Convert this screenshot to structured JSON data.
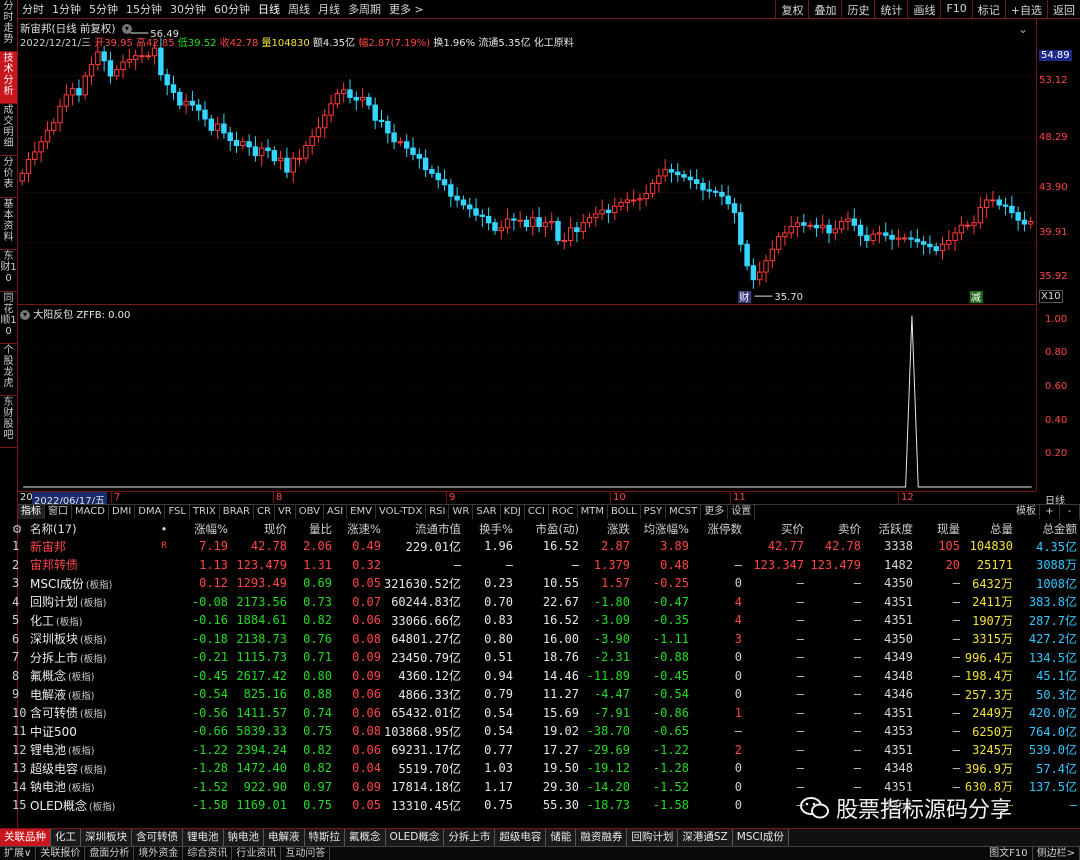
{
  "periods": [
    "分时",
    "1分钟",
    "5分钟",
    "15分钟",
    "30分钟",
    "60分钟",
    "日线",
    "周线",
    "月线",
    "多周期",
    "更多 >"
  ],
  "active_period": "日线",
  "top_buttons": [
    "复权",
    "叠加",
    "历史",
    "统计",
    "画线",
    "F10",
    "标记",
    "+自选",
    "返回"
  ],
  "left_tabs": [
    "分时走势",
    "技术分析",
    "成交明细",
    "分价表",
    "基本资料",
    "东财10",
    "同花顺10",
    "个股龙虎",
    "东财股吧"
  ],
  "active_left_tab": "技术分析",
  "chart_title": "新宙邦(日线 前复权)",
  "info": {
    "date": "2022/12/21/三",
    "open_label": "开",
    "open": "39.95",
    "high_label": "高",
    "high": "42.85",
    "low_label": "低",
    "low": "39.52",
    "close_label": "收",
    "close": "42.78",
    "vol_label": "量",
    "vol": "104830",
    "amt_label": "额",
    "amt": "4.35亿",
    "chg_label": "幅",
    "chg": "2.87(7.19%)",
    "turn": "换1.96%",
    "float": "流通5.35亿",
    "industry": "化工原料"
  },
  "price_scale": [
    "54.89",
    "53.12",
    "48.29",
    "43.90",
    "39.91",
    "35.92"
  ],
  "price_scale_highlight": "54.89",
  "annot_high": "56.49",
  "annot_low": "35.70",
  "marker_cai": "财",
  "marker_jian": "减",
  "x10": "X10",
  "indicator_title": "大阳反包",
  "indicator_value": "ZFFB: 0.00",
  "ind_scale": [
    "1.00",
    "0.80",
    "0.60",
    "0.40",
    "0.20"
  ],
  "x_date_box": "2022/06/17/五",
  "x_lead": "20",
  "x_ticks": [
    "7",
    "8",
    "9",
    "10",
    "11",
    "12"
  ],
  "ind_tabs": [
    "指标",
    "窗口",
    "MACD",
    "DMI",
    "DMA",
    "FSL",
    "TRIX",
    "BRAR",
    "CR",
    "VR",
    "OBV",
    "ASI",
    "EMV",
    "VOL-TDX",
    "RSI",
    "WR",
    "SAR",
    "KDJ",
    "CCI",
    "ROC",
    "MTM",
    "BOLL",
    "PSY",
    "MCST",
    "更多",
    "设置"
  ],
  "ind_tabs_right": [
    "模板",
    "+",
    "-"
  ],
  "table_headers": [
    "",
    "名称(17)",
    "•",
    "涨幅%",
    "现价",
    "量比",
    "涨速%",
    "流通市值",
    "换手%",
    "市盈(动)",
    "涨跌",
    "均涨幅%",
    "涨停数",
    "买价",
    "卖价",
    "活跃度",
    "现量",
    "总量",
    "总金额"
  ],
  "rows": [
    {
      "idx": "1",
      "name": "新宙邦",
      "sub": "",
      "mark": "R",
      "chg": "7.19",
      "price": "42.78",
      "lb": "2.06",
      "spd": "0.49",
      "mv": "229.01亿",
      "turn": "1.96",
      "pe": "16.52",
      "diff": "2.87",
      "avg": "3.89",
      "zt": "",
      "bid": "42.77",
      "ask": "42.78",
      "act": "3338",
      "cur": "105",
      "vol": "104830",
      "amt": "4.35亿"
    },
    {
      "idx": "2",
      "name": "宙邦转债",
      "sub": "",
      "mark": "",
      "chg": "1.13",
      "price": "123.479",
      "lb": "1.31",
      "spd": "0.32",
      "mv": "–",
      "turn": "–",
      "pe": "–",
      "diff": "1.379",
      "avg": "0.48",
      "zt": "–",
      "bid": "123.347",
      "ask": "123.479",
      "act": "1482",
      "cur": "20",
      "vol": "25171",
      "amt": "3088万"
    },
    {
      "idx": "3",
      "name": "MSCI成份",
      "sub": "(板指)",
      "mark": "",
      "chg": "0.12",
      "price": "1293.49",
      "lb": "0.69",
      "spd": "0.05",
      "mv": "321630.52亿",
      "turn": "0.23",
      "pe": "10.55",
      "diff": "1.57",
      "avg": "-0.25",
      "zt": "0",
      "bid": "–",
      "ask": "–",
      "act": "4350",
      "cur": "–",
      "vol": "6432万",
      "amt": "1008亿"
    },
    {
      "idx": "4",
      "name": "回购计划",
      "sub": "(板指)",
      "mark": "",
      "chg": "-0.08",
      "price": "2173.56",
      "lb": "0.73",
      "spd": "0.07",
      "mv": "60244.83亿",
      "turn": "0.70",
      "pe": "22.67",
      "diff": "-1.80",
      "avg": "-0.47",
      "zt": "4",
      "bid": "–",
      "ask": "–",
      "act": "4351",
      "cur": "–",
      "vol": "2411万",
      "amt": "383.8亿"
    },
    {
      "idx": "5",
      "name": "化工",
      "sub": "(板指)",
      "mark": "",
      "chg": "-0.16",
      "price": "1884.61",
      "lb": "0.82",
      "spd": "0.06",
      "mv": "33066.66亿",
      "turn": "0.83",
      "pe": "16.52",
      "diff": "-3.09",
      "avg": "-0.35",
      "zt": "4",
      "bid": "–",
      "ask": "–",
      "act": "4351",
      "cur": "–",
      "vol": "1907万",
      "amt": "287.7亿"
    },
    {
      "idx": "6",
      "name": "深圳板块",
      "sub": "(板指)",
      "mark": "",
      "chg": "-0.18",
      "price": "2138.73",
      "lb": "0.76",
      "spd": "0.08",
      "mv": "64801.27亿",
      "turn": "0.80",
      "pe": "16.00",
      "diff": "-3.90",
      "avg": "-1.11",
      "zt": "3",
      "bid": "–",
      "ask": "–",
      "act": "4350",
      "cur": "–",
      "vol": "3315万",
      "amt": "427.2亿"
    },
    {
      "idx": "7",
      "name": "分拆上市",
      "sub": "(板指)",
      "mark": "",
      "chg": "-0.21",
      "price": "1115.73",
      "lb": "0.71",
      "spd": "0.09",
      "mv": "23450.79亿",
      "turn": "0.51",
      "pe": "18.76",
      "diff": "-2.31",
      "avg": "-0.88",
      "zt": "0",
      "bid": "–",
      "ask": "–",
      "act": "4349",
      "cur": "–",
      "vol": "996.4万",
      "amt": "134.5亿"
    },
    {
      "idx": "8",
      "name": "氟概念",
      "sub": "(板指)",
      "mark": "",
      "chg": "-0.45",
      "price": "2617.42",
      "lb": "0.80",
      "spd": "0.09",
      "mv": "4360.12亿",
      "turn": "0.94",
      "pe": "14.46",
      "diff": "-11.89",
      "avg": "-0.45",
      "zt": "0",
      "bid": "–",
      "ask": "–",
      "act": "4348",
      "cur": "–",
      "vol": "198.4万",
      "amt": "45.1亿"
    },
    {
      "idx": "9",
      "name": "电解液",
      "sub": "(板指)",
      "mark": "",
      "chg": "-0.54",
      "price": "825.16",
      "lb": "0.88",
      "spd": "0.06",
      "mv": "4866.33亿",
      "turn": "0.79",
      "pe": "11.27",
      "diff": "-4.47",
      "avg": "-0.54",
      "zt": "0",
      "bid": "–",
      "ask": "–",
      "act": "4346",
      "cur": "–",
      "vol": "257.3万",
      "amt": "50.3亿"
    },
    {
      "idx": "10",
      "name": "含可转债",
      "sub": "(板指)",
      "mark": "",
      "chg": "-0.56",
      "price": "1411.57",
      "lb": "0.74",
      "spd": "0.06",
      "mv": "65432.01亿",
      "turn": "0.54",
      "pe": "15.69",
      "diff": "-7.91",
      "avg": "-0.86",
      "zt": "1",
      "bid": "–",
      "ask": "–",
      "act": "4351",
      "cur": "–",
      "vol": "2449万",
      "amt": "420.0亿"
    },
    {
      "idx": "11",
      "name": "中证500",
      "sub": "",
      "mark": "",
      "chg": "-0.66",
      "price": "5839.33",
      "lb": "0.75",
      "spd": "0.08",
      "mv": "103868.95亿",
      "turn": "0.54",
      "pe": "19.02",
      "diff": "-38.70",
      "avg": "-0.65",
      "zt": "–",
      "bid": "–",
      "ask": "–",
      "act": "4353",
      "cur": "–",
      "vol": "6250万",
      "amt": "764.0亿"
    },
    {
      "idx": "12",
      "name": "锂电池",
      "sub": "(板指)",
      "mark": "",
      "chg": "-1.22",
      "price": "2394.24",
      "lb": "0.82",
      "spd": "0.06",
      "mv": "69231.17亿",
      "turn": "0.77",
      "pe": "17.27",
      "diff": "-29.69",
      "avg": "-1.22",
      "zt": "2",
      "bid": "–",
      "ask": "–",
      "act": "4351",
      "cur": "–",
      "vol": "3245万",
      "amt": "539.0亿"
    },
    {
      "idx": "13",
      "name": "超级电容",
      "sub": "(板指)",
      "mark": "",
      "chg": "-1.28",
      "price": "1472.40",
      "lb": "0.82",
      "spd": "0.04",
      "mv": "5519.70亿",
      "turn": "1.03",
      "pe": "19.50",
      "diff": "-19.12",
      "avg": "-1.28",
      "zt": "0",
      "bid": "–",
      "ask": "–",
      "act": "4348",
      "cur": "–",
      "vol": "396.9万",
      "amt": "57.4亿"
    },
    {
      "idx": "14",
      "name": "钠电池",
      "sub": "(板指)",
      "mark": "",
      "chg": "-1.52",
      "price": "922.90",
      "lb": "0.97",
      "spd": "0.09",
      "mv": "17814.18亿",
      "turn": "1.17",
      "pe": "29.30",
      "diff": "-14.20",
      "avg": "-1.52",
      "zt": "0",
      "bid": "–",
      "ask": "–",
      "act": "4351",
      "cur": "–",
      "vol": "630.8万",
      "amt": "137.5亿"
    },
    {
      "idx": "15",
      "name": "OLED概念",
      "sub": "(板指)",
      "mark": "",
      "chg": "-1.58",
      "price": "1169.01",
      "lb": "0.75",
      "spd": "0.05",
      "mv": "13310.45亿",
      "turn": "0.75",
      "pe": "55.30",
      "diff": "-18.73",
      "avg": "-1.58",
      "zt": "0",
      "bid": "–",
      "ask": "–",
      "act": "4351",
      "cur": "–",
      "vol": "–",
      "amt": "–"
    }
  ],
  "bottom_tabs": [
    "关联品种",
    "化工",
    "深圳板块",
    "含可转债",
    "锂电池",
    "钠电池",
    "电解液",
    "特斯拉",
    "氟概念",
    "OLED概念",
    "分拆上市",
    "超级电容",
    "储能",
    "融资融券",
    "回购计划",
    "深港通SZ",
    "MSCI成份"
  ],
  "active_bottom_tab": "关联品种",
  "status_items": [
    "扩展∨",
    "关联报价",
    "盘面分析",
    "境外资金",
    "综合资讯",
    "行业资讯",
    "互动问答"
  ],
  "status_right": [
    "图文F10",
    "侧边栏>"
  ],
  "watermark": "股票指标源码分享",
  "candles": {
    "n": 161,
    "opens": [
      44.8,
      45.4,
      46.5,
      47.1,
      47.9,
      48.8,
      49.4,
      50.7,
      51.6,
      52.1,
      51.6,
      53.1,
      54.0,
      55.0,
      54.3,
      53.1,
      53.6,
      54.2,
      54.4,
      54.7,
      54.7,
      54.7,
      55.3,
      53.2,
      52.4,
      51.8,
      50.8,
      51.1,
      50.8,
      50.4,
      49.7,
      48.8,
      49.3,
      48.6,
      48.0,
      47.6,
      47.9,
      47.5,
      46.8,
      47.4,
      47.2,
      46.4,
      46.6,
      45.5,
      46.6,
      46.6,
      47.6,
      48.3,
      49.0,
      50.0,
      50.9,
      51.7,
      52.0,
      51.4,
      51.2,
      51.4,
      50.8,
      49.6,
      49.5,
      48.6,
      47.9,
      47.9,
      47.4,
      46.9,
      46.6,
      45.7,
      45.4,
      44.9,
      44.5,
      43.6,
      43.3,
      42.9,
      42.6,
      42.1,
      42.0,
      41.5,
      40.9,
      41.1,
      41.8,
      41.7,
      41.7,
      41.2,
      41.9,
      41.2,
      41.5,
      41.6,
      40.1,
      40.1,
      41.1,
      40.8,
      41.5,
      41.9,
      42.2,
      42.5,
      42.3,
      42.8,
      43.1,
      43.3,
      43.3,
      43.4,
      43.8,
      44.6,
      45.2,
      45.7,
      45.5,
      45.3,
      45.1,
      44.9,
      44.6,
      44.1,
      44.0,
      43.9,
      43.6,
      43.0,
      42.3,
      39.8,
      38.1,
      37.0,
      37.6,
      38.5,
      39.4,
      40.4,
      40.7,
      41.2,
      41.5,
      41.3,
      41.3,
      41.1,
      41.3,
      40.7,
      41.0,
      41.6,
      41.8,
      41.3,
      40.5,
      40.1,
      40.6,
      40.7,
      40.5,
      40.2,
      40.3,
      40.3,
      40.2,
      40.0,
      39.8,
      39.6,
      39.3,
      39.8,
      40.1,
      40.7,
      41.3,
      41.3,
      41.5,
      42.7,
      43.3,
      43.3,
      42.9,
      42.8,
      42.3,
      41.7,
      41.4,
      41.6,
      40.9
    ],
    "closes": [
      45.4,
      46.5,
      47.1,
      47.9,
      48.8,
      49.4,
      50.7,
      51.6,
      52.1,
      51.6,
      53.1,
      54.0,
      55.0,
      54.3,
      53.1,
      53.6,
      54.2,
      54.4,
      54.7,
      54.7,
      54.7,
      55.3,
      53.2,
      52.4,
      51.8,
      50.8,
      51.1,
      50.8,
      50.4,
      49.7,
      48.8,
      49.3,
      48.6,
      48.0,
      47.6,
      47.9,
      47.5,
      46.8,
      47.4,
      47.2,
      46.4,
      46.6,
      45.5,
      46.6,
      46.6,
      47.6,
      48.3,
      49.0,
      50.0,
      50.9,
      51.7,
      52.0,
      51.4,
      51.2,
      51.4,
      50.8,
      49.6,
      49.5,
      48.6,
      47.9,
      47.9,
      47.4,
      46.9,
      46.6,
      45.7,
      45.4,
      44.9,
      44.5,
      43.6,
      43.3,
      42.9,
      42.6,
      42.1,
      42.0,
      41.5,
      40.9,
      41.1,
      41.8,
      41.7,
      41.7,
      41.2,
      41.9,
      41.2,
      41.5,
      41.6,
      40.1,
      40.1,
      41.1,
      40.8,
      41.5,
      41.9,
      42.2,
      42.5,
      42.3,
      42.8,
      43.1,
      43.3,
      43.3,
      43.4,
      43.8,
      44.6,
      45.2,
      45.7,
      45.5,
      45.3,
      45.1,
      44.9,
      44.6,
      44.1,
      44.0,
      43.9,
      43.6,
      43.0,
      42.3,
      39.8,
      38.1,
      37.0,
      37.6,
      38.5,
      39.4,
      40.4,
      40.7,
      41.2,
      41.5,
      41.3,
      41.3,
      41.1,
      41.3,
      40.7,
      41.0,
      41.6,
      41.8,
      41.3,
      40.5,
      40.1,
      40.6,
      40.7,
      40.5,
      40.2,
      40.3,
      40.3,
      40.2,
      40.0,
      39.8,
      39.6,
      39.3,
      39.8,
      40.1,
      40.7,
      41.3,
      41.3,
      41.5,
      42.7,
      43.3,
      43.3,
      42.9,
      42.8,
      42.3,
      41.7,
      41.4,
      41.6,
      40.9,
      42.8
    ]
  },
  "indicator_spike_index": 141
}
